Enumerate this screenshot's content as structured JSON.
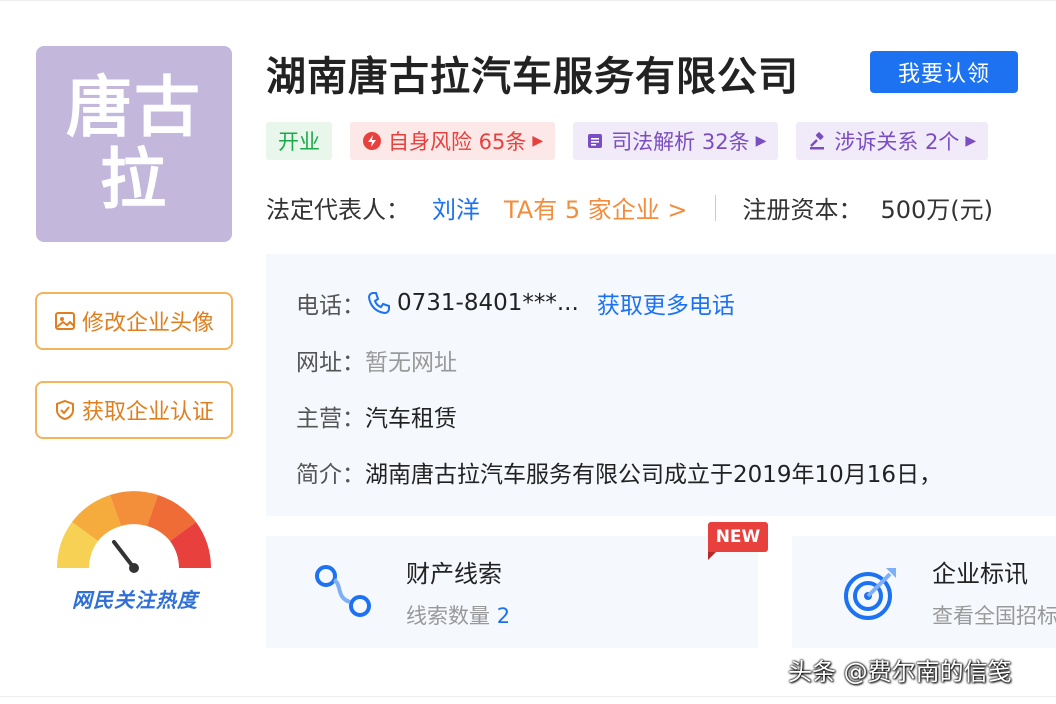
{
  "logo": {
    "text": "唐古拉"
  },
  "sidebar": {
    "edit_avatar_label": "修改企业头像",
    "certify_label": "获取企业认证",
    "heat_label": "网民关注热度"
  },
  "header": {
    "company_name": "湖南唐古拉汽车服务有限公司",
    "claim_label": "我要认领"
  },
  "tags": {
    "status": "开业",
    "risk": "自身风险 65条",
    "judicial": "司法解析 32条",
    "relation": "涉诉关系 2个"
  },
  "legal": {
    "label": "法定代表人：",
    "name": "刘洋",
    "companies": "TA有 5 家企业 >",
    "capital_label": "注册资本：",
    "capital_value": "500万(元)"
  },
  "info": {
    "phone_label": "电话：",
    "phone_value": "0731-8401***...",
    "phone_more": "获取更多电话",
    "website_label": "网址：",
    "website_value": "暂无网址",
    "business_label": "主营：",
    "business_value": "汽车租赁",
    "intro_label": "简介：",
    "intro_value": "湖南唐古拉汽车服务有限公司成立于2019年10月16日，"
  },
  "cards": [
    {
      "title": "财产线索",
      "sub_label": "线索数量 ",
      "sub_value": "2",
      "badge": "NEW"
    },
    {
      "title": "企业标讯",
      "sub_label": "查看全国招标"
    }
  ],
  "watermark": "头条 @费尔南的信笺",
  "colors": {
    "accent": "#1d72f2",
    "logo_bg": "#c3b8dc",
    "risk": "#e8403d",
    "open": "#1eaa4b",
    "orange": "#f28d3d"
  }
}
